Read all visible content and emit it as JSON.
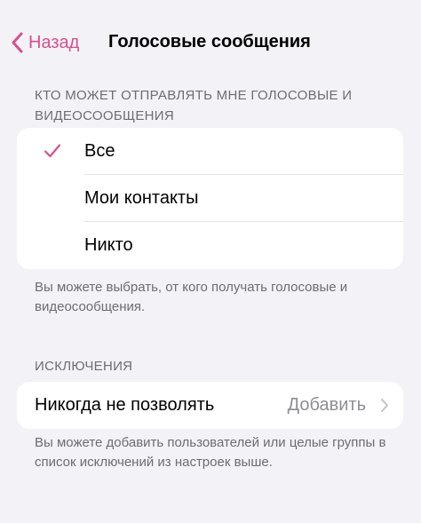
{
  "nav": {
    "back_label": "Назад",
    "title": "Голосовые сообщения"
  },
  "who_section": {
    "header": "КТО МОЖЕТ ОТПРАВЛЯТЬ МНЕ ГОЛОСОВЫЕ И ВИДЕОСООБЩЕНИЯ",
    "options": [
      {
        "label": "Все",
        "selected": true
      },
      {
        "label": "Мои контакты",
        "selected": false
      },
      {
        "label": "Никто",
        "selected": false
      }
    ],
    "footer": "Вы можете выбрать, от кого получать голосовые и видеосообщения."
  },
  "exceptions_section": {
    "header": "ИСКЛЮЧЕНИЯ",
    "row_label": "Никогда не позволять",
    "row_value": "Добавить",
    "footer": "Вы можете добавить пользователей или целые группы в список исключений из настроек выше."
  },
  "colors": {
    "accent": "#d94f8c",
    "background": "#f2f2f7",
    "secondary_text": "#6d6d72"
  },
  "icons": {
    "back": "chevron-left-icon",
    "check": "checkmark-icon",
    "disclosure": "chevron-right-icon"
  }
}
